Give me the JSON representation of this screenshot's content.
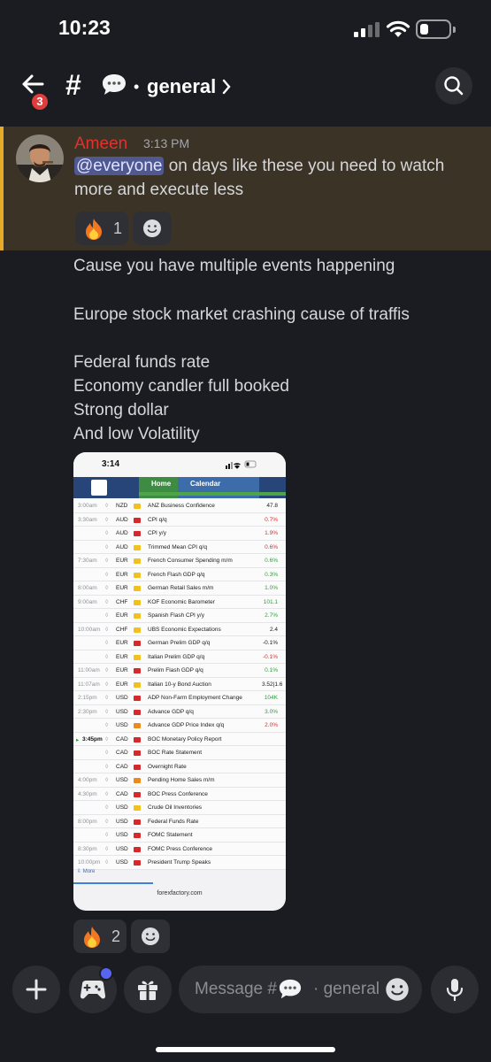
{
  "status_bar": {
    "time": "10:23"
  },
  "header": {
    "back_badge": "3",
    "hash": "#",
    "channel_emoji": "speech-bubble-emoji",
    "separator": "•",
    "channel_name": "general"
  },
  "mention_message": {
    "author": "Ameen",
    "author_color": "#e3312e",
    "timestamp": "3:13 PM",
    "mention": "@everyone",
    "text_line1": " on days like these you need to watch",
    "text_line2": "more and execute less",
    "reaction_count": "1"
  },
  "body_lines": [
    "Cause you have multiple events happening",
    "Europe stock market crashing cause of traffis",
    "Federal funds rate",
    "Economy candler full booked",
    "Strong dollar",
    "And low Volatility"
  ],
  "attachment": {
    "status_time": "3:14",
    "nav_home": "Home",
    "nav_calendar": "Calendar",
    "rows": [
      {
        "time": "3:00am",
        "cur": "NZD",
        "impact": "yellow",
        "event": "ANZ Business Confidence",
        "actual": "47.8",
        "actual_color": "#1a1a1a"
      },
      {
        "time": "3:30am",
        "cur": "AUD",
        "impact": "red",
        "event": "CPI q/q",
        "actual": "0.7%",
        "actual_color": "#d32f2f"
      },
      {
        "time": "",
        "cur": "AUD",
        "impact": "red",
        "event": "CPI y/y",
        "actual": "1.9%",
        "actual_color": "#d32f2f"
      },
      {
        "time": "",
        "cur": "AUD",
        "impact": "yellow",
        "event": "Trimmed Mean CPI q/q",
        "actual": "0.6%",
        "actual_color": "#d32f2f"
      },
      {
        "time": "7:30am",
        "cur": "EUR",
        "impact": "yellow",
        "event": "French Consumer Spending m/m",
        "actual": "0.6%",
        "actual_color": "#2e9d3a"
      },
      {
        "time": "",
        "cur": "EUR",
        "impact": "yellow",
        "event": "French Flash GDP q/q",
        "actual": "0.3%",
        "actual_color": "#2e9d3a"
      },
      {
        "time": "8:00am",
        "cur": "EUR",
        "impact": "yellow",
        "event": "German Retail Sales m/m",
        "actual": "1.0%",
        "actual_color": "#2e9d3a"
      },
      {
        "time": "9:00am",
        "cur": "CHF",
        "impact": "yellow",
        "event": "KOF Economic Barometer",
        "actual": "101.1",
        "actual_color": "#2e9d3a"
      },
      {
        "time": "",
        "cur": "EUR",
        "impact": "yellow",
        "event": "Spanish Flash CPI y/y",
        "actual": "2.7%",
        "actual_color": "#2e9d3a"
      },
      {
        "time": "10:00am",
        "cur": "CHF",
        "impact": "yellow",
        "event": "UBS Economic Expectations",
        "actual": "2.4",
        "actual_color": "#1a1a1a"
      },
      {
        "time": "",
        "cur": "EUR",
        "impact": "red",
        "event": "German Prelim GDP q/q",
        "actual": "-0.1%",
        "actual_color": "#1a1a1a"
      },
      {
        "time": "",
        "cur": "EUR",
        "impact": "yellow",
        "event": "Italian Prelim GDP q/q",
        "actual": "-0.1%",
        "actual_color": "#d32f2f"
      },
      {
        "time": "11:00am",
        "cur": "EUR",
        "impact": "red",
        "event": "Prelim Flash GDP q/q",
        "actual": "0.1%",
        "actual_color": "#2e9d3a"
      },
      {
        "time": "11:07am",
        "cur": "EUR",
        "impact": "yellow",
        "event": "Italian 10-y Bond Auction",
        "actual": "3.52|1.6",
        "actual_color": "#1a1a1a"
      },
      {
        "time": "2:15pm",
        "cur": "USD",
        "impact": "red",
        "event": "ADP Non-Farm Employment Change",
        "actual": "104K",
        "actual_color": "#2e9d3a"
      },
      {
        "time": "2:30pm",
        "cur": "USD",
        "impact": "red",
        "event": "Advance GDP q/q",
        "actual": "3.0%",
        "actual_color": "#2e9d3a"
      },
      {
        "time": "",
        "cur": "USD",
        "impact": "orange",
        "event": "Advance GDP Price Index q/q",
        "actual": "2.0%",
        "actual_color": "#d32f2f"
      },
      {
        "time": "3:45pm",
        "cur": "CAD",
        "impact": "red",
        "event": "BOC Monetary Policy Report",
        "actual": "",
        "actual_color": "#1a1a1a",
        "current": true
      },
      {
        "time": "",
        "cur": "CAD",
        "impact": "red",
        "event": "BOC Rate Statement",
        "actual": "",
        "actual_color": "#1a1a1a"
      },
      {
        "time": "",
        "cur": "CAD",
        "impact": "red",
        "event": "Overnight Rate",
        "actual": "",
        "actual_color": "#1a1a1a"
      },
      {
        "time": "4:00pm",
        "cur": "USD",
        "impact": "orange",
        "event": "Pending Home Sales m/m",
        "actual": "",
        "actual_color": "#1a1a1a"
      },
      {
        "time": "4:30pm",
        "cur": "CAD",
        "impact": "red",
        "event": "BOC Press Conference",
        "actual": "",
        "actual_color": "#1a1a1a"
      },
      {
        "time": "",
        "cur": "USD",
        "impact": "yellow",
        "event": "Crude Oil Inventories",
        "actual": "",
        "actual_color": "#1a1a1a"
      },
      {
        "time": "8:00pm",
        "cur": "USD",
        "impact": "red",
        "event": "Federal Funds Rate",
        "actual": "",
        "actual_color": "#1a1a1a"
      },
      {
        "time": "",
        "cur": "USD",
        "impact": "red",
        "event": "FOMC Statement",
        "actual": "",
        "actual_color": "#1a1a1a"
      },
      {
        "time": "8:30pm",
        "cur": "USD",
        "impact": "red",
        "event": "FOMC Press Conference",
        "actual": "",
        "actual_color": "#1a1a1a"
      },
      {
        "time": "10:00pm",
        "cur": "USD",
        "impact": "red",
        "event": "President Trump Speaks",
        "actual": "",
        "actual_color": "#1a1a1a"
      }
    ],
    "more_label": "More",
    "url": "forexfactory.com"
  },
  "second_reaction_count": "2",
  "composer": {
    "placeholder_left": "Message #",
    "placeholder_right": "· general"
  }
}
